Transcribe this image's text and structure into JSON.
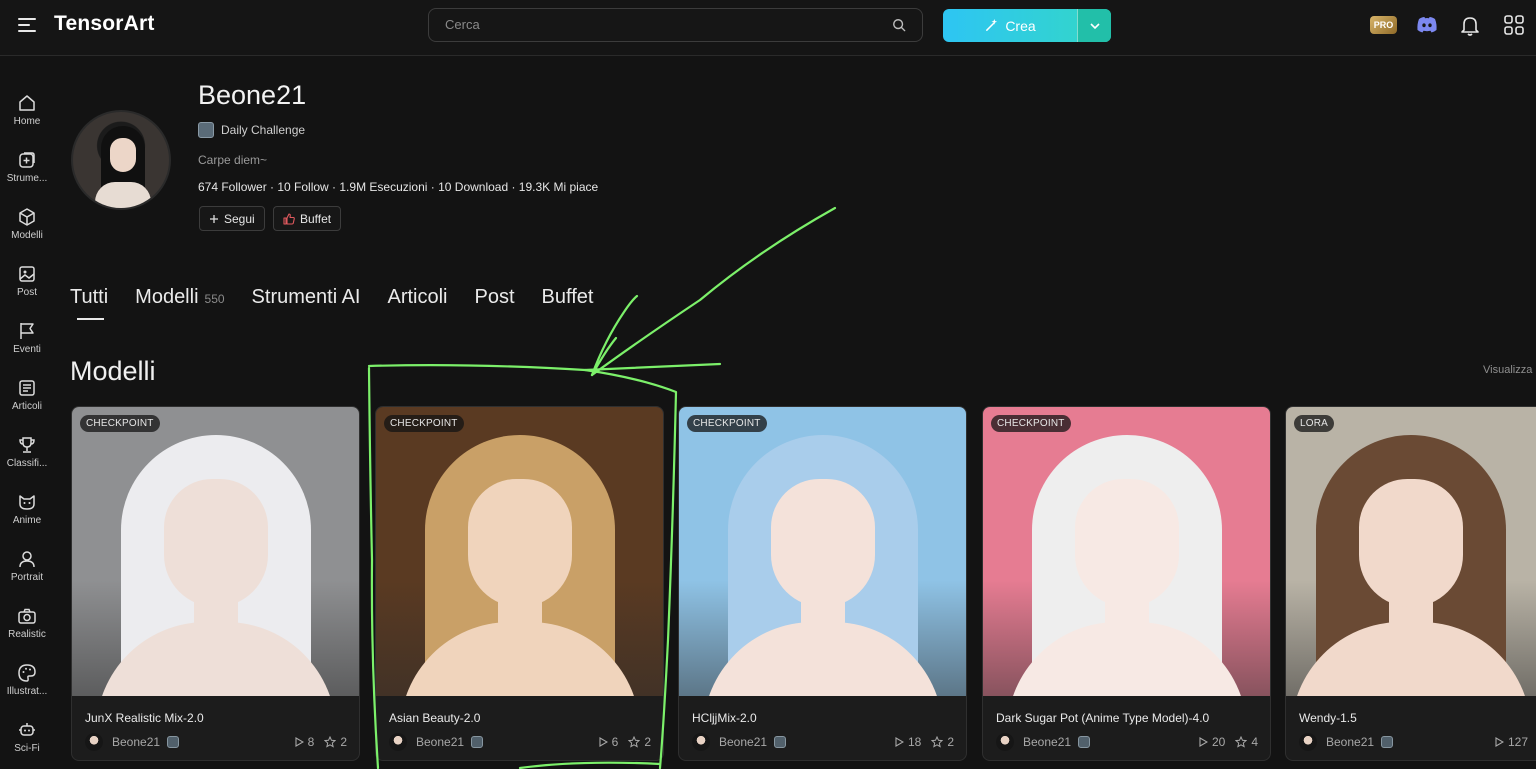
{
  "app": {
    "logo": "TensorArt"
  },
  "search": {
    "placeholder": "Cerca"
  },
  "create": {
    "label": "Crea"
  },
  "header": {
    "pro_badge": "PRO"
  },
  "sidebar": {
    "items": [
      {
        "label": "Home",
        "icon": "home-icon"
      },
      {
        "label": "Strume...",
        "icon": "tools-icon"
      },
      {
        "label": "Modelli",
        "icon": "cube-icon"
      },
      {
        "label": "Post",
        "icon": "image-icon"
      },
      {
        "label": "Eventi",
        "icon": "flag-icon"
      },
      {
        "label": "Articoli",
        "icon": "article-icon"
      },
      {
        "label": "Classifi...",
        "icon": "trophy-icon"
      },
      {
        "label": "Anime",
        "icon": "cat-icon"
      },
      {
        "label": "Portrait",
        "icon": "person-icon"
      },
      {
        "label": "Realistic",
        "icon": "camera-icon"
      },
      {
        "label": "Illustrat...",
        "icon": "palette-icon"
      },
      {
        "label": "Sci-Fi",
        "icon": "robot-icon"
      }
    ]
  },
  "profile": {
    "name": "Beone21",
    "challenge": "Daily Challenge",
    "bio": "Carpe diem~",
    "stats": "674 Follower · 10 Follow · 1.9M Esecuzioni · 10 Download · 19.3K Mi piace",
    "follow_label": "Segui",
    "buffet_label": "Buffet"
  },
  "tabs": [
    {
      "label": "Tutti",
      "count": ""
    },
    {
      "label": "Modelli",
      "count": "550"
    },
    {
      "label": "Strumenti AI",
      "count": ""
    },
    {
      "label": "Articoli",
      "count": ""
    },
    {
      "label": "Post",
      "count": ""
    },
    {
      "label": "Buffet",
      "count": ""
    }
  ],
  "section": {
    "title": "Modelli",
    "view_all": "Visualizza"
  },
  "cards": [
    {
      "type": "CHECKPOINT",
      "title": "JunX Realistic Mix-2.0",
      "author": "Beone21",
      "runs": "8",
      "stars": "2",
      "bg": "#8f9092",
      "hair": "#ececef",
      "skin": "#eedfd8"
    },
    {
      "type": "CHECKPOINT",
      "title": "Asian Beauty-2.0",
      "author": "Beone21",
      "runs": "6",
      "stars": "2",
      "bg": "#5a3a22",
      "hair": "#c9a067",
      "skin": "#f0d4bc"
    },
    {
      "type": "CHECKPOINT",
      "title": "HCljjMix-2.0",
      "author": "Beone21",
      "runs": "18",
      "stars": "2",
      "bg": "#8fc3e6",
      "hair": "#a9cdeb",
      "skin": "#f4e2da"
    },
    {
      "type": "CHECKPOINT",
      "title": "Dark Sugar Pot (Anime Type Model)-4.0",
      "author": "Beone21",
      "runs": "20",
      "stars": "4",
      "bg": "#e67c92",
      "hair": "#eeeeee",
      "skin": "#f7e9e4"
    },
    {
      "type": "LORA",
      "title": "Wendy-1.5",
      "author": "Beone21",
      "runs": "127",
      "stars": "",
      "bg": "#b9b3a6",
      "hair": "#6a4a34",
      "skin": "#f1d9cb"
    }
  ]
}
